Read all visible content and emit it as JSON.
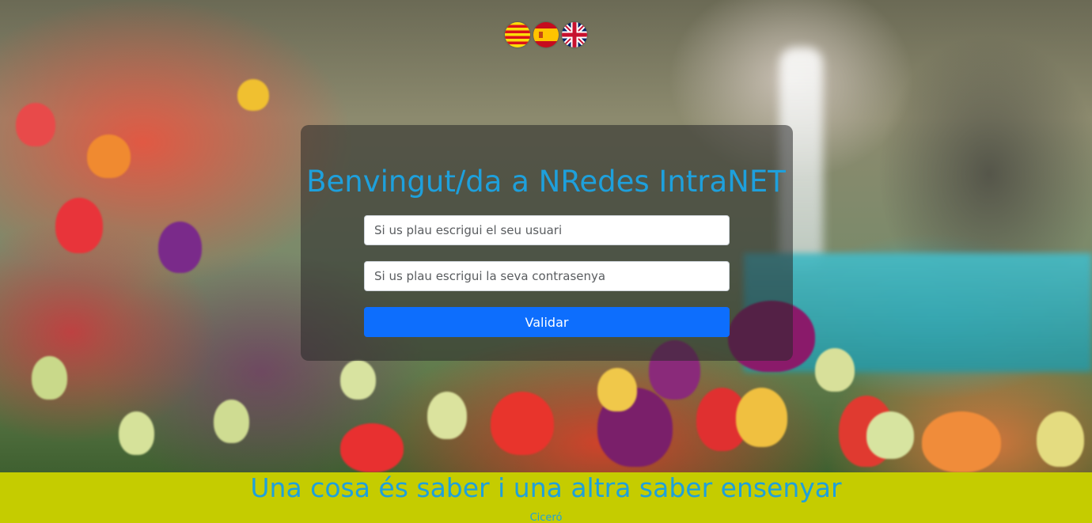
{
  "languages": [
    {
      "code": "ca",
      "label": "Català",
      "icon": "catalan-flag-icon"
    },
    {
      "code": "es",
      "label": "Español",
      "icon": "spanish-flag-icon"
    },
    {
      "code": "en",
      "label": "English",
      "icon": "uk-flag-icon"
    }
  ],
  "login": {
    "title": "Benvingut/da a NRedes IntraNET",
    "username_placeholder": "Si us plau escrigui el seu usuari",
    "username_value": "",
    "password_placeholder": "Si us plau escrigui la seva contrasenya",
    "password_value": "",
    "submit_label": "Validar"
  },
  "footer": {
    "quote": "Una cosa és saber i una altra saber ensenyar",
    "author": "Ciceró"
  },
  "colors": {
    "accent_text": "#1ea0dc",
    "button": "#0d6efd",
    "footer_bg": "#c5cc00",
    "card_overlay": "rgba(40,40,40,0.55)"
  }
}
